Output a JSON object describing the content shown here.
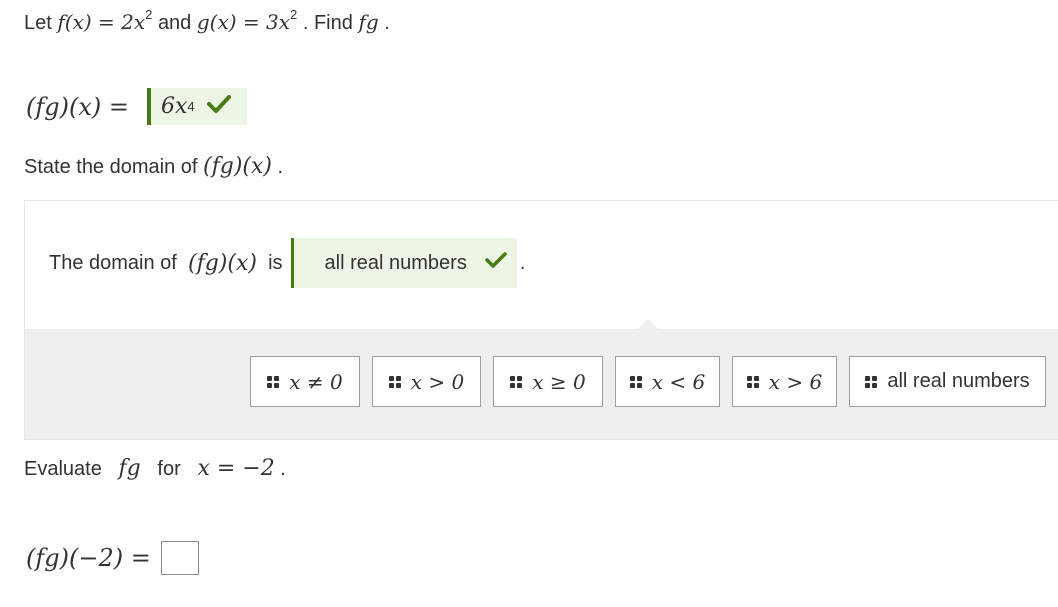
{
  "question1": {
    "prefix": "Let",
    "f_def": "f(x) = 2x",
    "exponent": "2",
    "and_word": "and",
    "g_def": "g(x) = 3x",
    "g_exponent": "2",
    "find_word": ". Find",
    "target": "fg",
    "end": "."
  },
  "answer1": {
    "lhs": "(fg)(x) =",
    "value": "6x",
    "exponent": "4",
    "status": "correct"
  },
  "question2": {
    "text": "State the domain of",
    "expr": "(fg)(x)",
    "end": "."
  },
  "domain_statement": {
    "prefix": "The domain of",
    "expr": "(fg)(x)",
    "is_word": "is",
    "answer": "all real numbers",
    "end": "."
  },
  "choices": [
    {
      "label": "x ≠ 0"
    },
    {
      "label": "x > 0"
    },
    {
      "label": "x ≥ 0"
    },
    {
      "label": "x < 6"
    },
    {
      "label": "x > 6"
    },
    {
      "label": "all real numbers"
    }
  ],
  "question3": {
    "text": "Evaluate",
    "expr": "fg",
    "for_word": "for",
    "value": "x = −2",
    "end": "."
  },
  "answer3": {
    "lhs": "(fg)(−2) =",
    "value": ""
  },
  "colors": {
    "correct_green": "#4a7a14",
    "correct_bg": "#edf5e6",
    "tray_bg": "#efefef"
  }
}
